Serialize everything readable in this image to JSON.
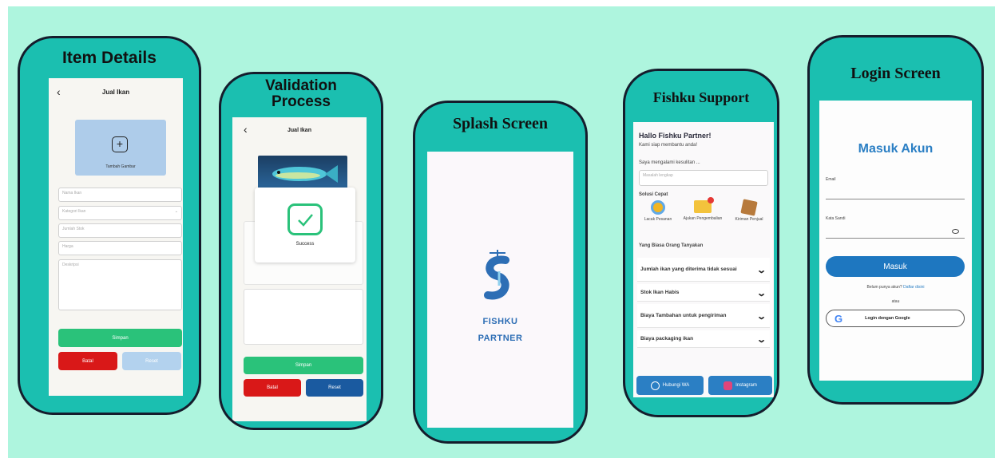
{
  "colors": {
    "background": "#aef5de",
    "phone_frame": "#1bbfb0",
    "primary_green": "#2ac27a",
    "danger_red": "#d91818",
    "navy": "#1a5aa0",
    "blue": "#2b7fc4"
  },
  "item_details": {
    "caption": "Item Details",
    "header_title": "Jual Ikan",
    "upload_label": "Tambah Gambar",
    "fields": [
      "Nama Ikan",
      "Kategori Ikan",
      "Jumlah Stok",
      "Harga",
      "Deskripsi"
    ],
    "submit_label": "Simpan",
    "cancel_label": "Batal",
    "reset_label": "Reset"
  },
  "validation": {
    "caption": "Validation Process",
    "header_title": "Jual Ikan",
    "dialog_text": "Success",
    "submit_label": "Simpan",
    "cancel_label": "Batal",
    "reset_label": "Reset"
  },
  "splash": {
    "caption": "Splash Screen",
    "brand_line1": "FISHKU",
    "brand_line2": "PARTNER"
  },
  "support": {
    "caption": "Fishku Support",
    "greeting": "Hallo Fishku Partner!",
    "subtitle": "Kami siap membantu anda!",
    "prompt": "Saya mengalami kesulitan ...",
    "input_placeholder": "Masalah lengkap",
    "quick_title": "Solusi Cepat",
    "quick_items": [
      "Lacak Pesanan",
      "Ajukan Pengembalian",
      "Kiriman Penjual"
    ],
    "faq_title": "Yang Biasa Orang Tanyakan",
    "faqs": [
      "Jumlah ikan yang diterima tidak sesuai",
      "Stok Ikan Habis",
      "Biaya Tambahan untuk pengiriman",
      "Biaya packaging ikan"
    ],
    "whatsapp_label": "Hubungi WA",
    "instagram_label": "Instagram"
  },
  "login": {
    "caption": "Login Screen",
    "heading": "Masuk Akun",
    "email_label": "Email",
    "password_label": "Kata Sandi",
    "login_button": "Masuk",
    "register_prompt": "Belum punya akun?",
    "register_link": "Daftar disini",
    "or_label": "atau",
    "google_button": "Login dengan Google"
  }
}
